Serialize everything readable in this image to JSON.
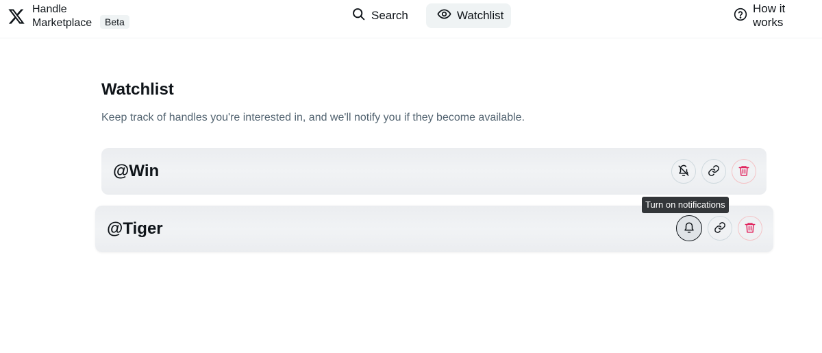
{
  "header": {
    "brand": {
      "line1": "Handle",
      "line2": "Marketplace",
      "badge": "Beta"
    },
    "nav": {
      "search": "Search",
      "watchlist": "Watchlist",
      "how_it_works": "How it works"
    }
  },
  "main": {
    "title": "Watchlist",
    "subtitle": "Keep track of handles you're interested in, and we'll notify you if they become available."
  },
  "watchlist": [
    {
      "handle": "@Win",
      "notifications": "off"
    },
    {
      "handle": "@Tiger",
      "notifications": "off"
    }
  ],
  "tooltip": "Turn on notifications",
  "colors": {
    "delete": "#e0245e",
    "row_bg": "#eceef1",
    "tooltip_bg": "#333639"
  },
  "icons": [
    "x-logo-icon",
    "search-icon",
    "eye-icon",
    "question-circle-icon",
    "bell-off-icon",
    "bell-icon",
    "link-icon",
    "trash-icon"
  ]
}
